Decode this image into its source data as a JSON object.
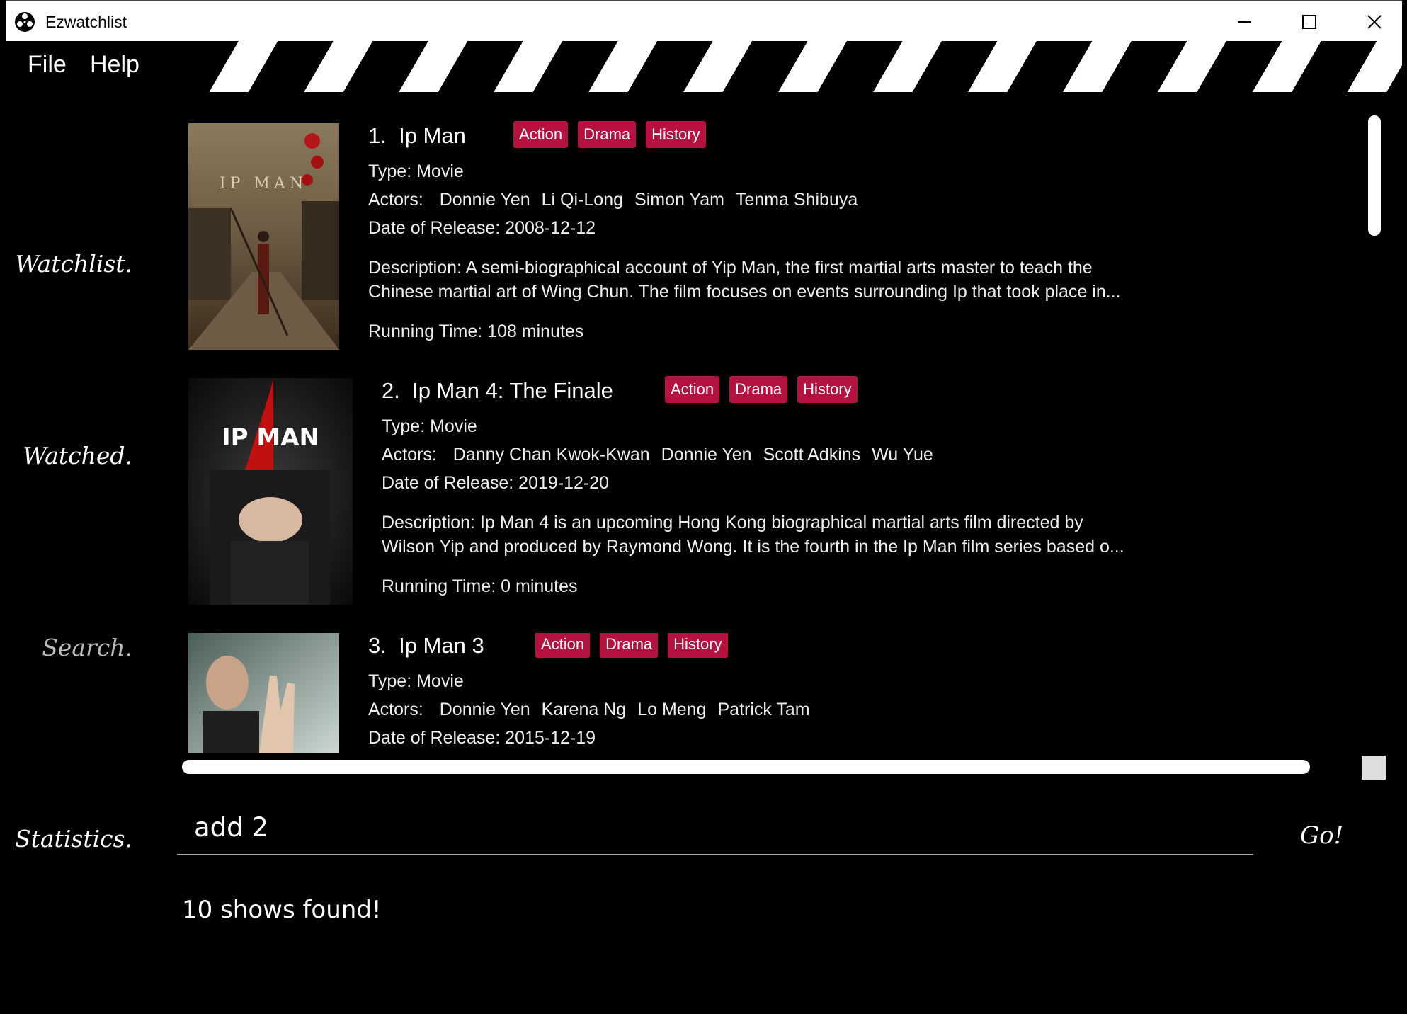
{
  "window": {
    "title": "Ezwatchlist"
  },
  "menu": {
    "file": "File",
    "help": "Help"
  },
  "nav": {
    "watchlist": "Watchlist.",
    "watched": "Watched.",
    "search": "Search.",
    "statistics": "Statistics."
  },
  "shows": [
    {
      "index": "1.",
      "title": "Ip Man",
      "genres": [
        "Action",
        "Drama",
        "History"
      ],
      "type": "Type: Movie",
      "actors_label": "Actors:",
      "actors": [
        "Donnie Yen",
        "Li Qi-Long",
        "Simon Yam",
        "Tenma Shibuya"
      ],
      "release": "Date of Release: 2008-12-12",
      "description_1": "Description: A semi-biographical account of Yip Man, the first martial arts master to teach the",
      "description_2": "Chinese martial art of Wing Chun. The film focuses on events surrounding Ip that took place in...",
      "running": "Running Time: 108 minutes",
      "poster_text": "IP MAN"
    },
    {
      "index": "2.",
      "title": "Ip Man 4: The Finale",
      "genres": [
        "Action",
        "Drama",
        "History"
      ],
      "type": "Type: Movie",
      "actors_label": "Actors:",
      "actors": [
        "Danny Chan Kwok-Kwan",
        "Donnie Yen",
        "Scott Adkins",
        "Wu Yue"
      ],
      "release": "Date of Release: 2019-12-20",
      "description_1": "Description: Ip Man 4 is an upcoming Hong Kong biographical martial arts film directed by",
      "description_2": "Wilson Yip and produced by Raymond Wong. It is the fourth in the Ip Man film series based o...",
      "running": "Running Time: 0 minutes",
      "poster_text": "IP MAN"
    },
    {
      "index": "3.",
      "title": "Ip Man 3",
      "genres": [
        "Action",
        "Drama",
        "History"
      ],
      "type": "Type: Movie",
      "actors_label": "Actors:",
      "actors": [
        "Donnie Yen",
        "Karena Ng",
        "Lo Meng",
        "Patrick Tam"
      ],
      "release": "Date of Release: 2015-12-19"
    }
  ],
  "command": {
    "value": "add 2",
    "go_label": "Go!"
  },
  "result": {
    "message": "10 shows found!"
  },
  "colors": {
    "tag_bg": "#b5123f",
    "background": "#000000"
  }
}
